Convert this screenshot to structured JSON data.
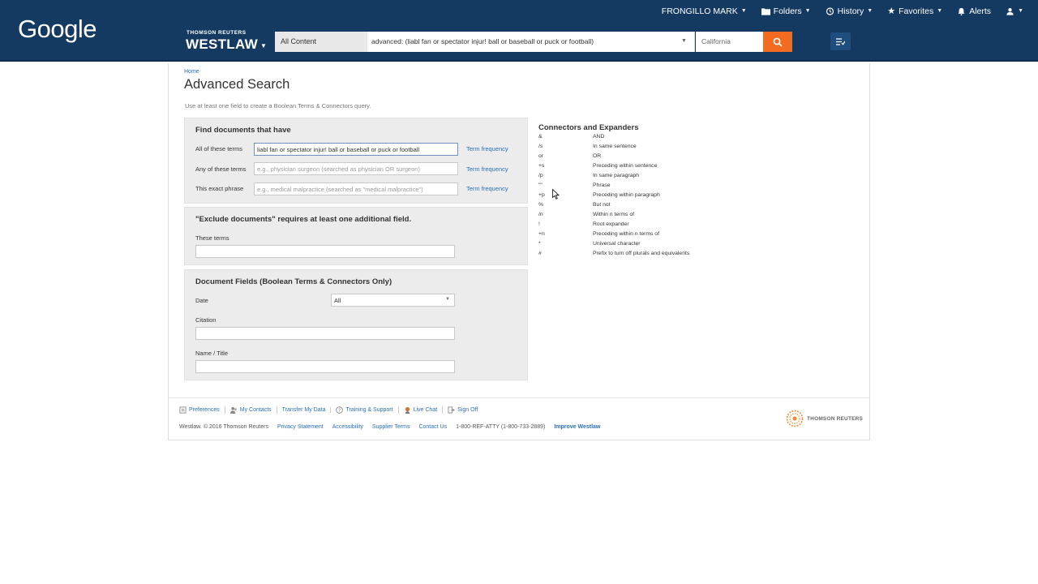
{
  "browser": {
    "logo": "Google"
  },
  "userbar": {
    "user": "FRONGILLO MARK",
    "folders": "Folders",
    "history": "History",
    "favorites": "Favorites",
    "alerts": "Alerts"
  },
  "brand": {
    "small": "THOMSON REUTERS",
    "big": "WESTLAW"
  },
  "search": {
    "content_type": "All Content",
    "query": "advanced: (liabl fan or spectator injur! ball or baseball or puck or football)",
    "jurisdiction": "California"
  },
  "page": {
    "breadcrumb": "Home",
    "title": "Advanced Search",
    "intro": "Use at least one field to create a Boolean Terms & Connectors query."
  },
  "find_panel": {
    "heading": "Find documents that have",
    "rows": [
      {
        "label": "All of these terms",
        "value": "liabl fan or spectator injur! ball or baseball or puck or football",
        "placeholder": "",
        "link": "Term frequency"
      },
      {
        "label": "Any of these terms",
        "value": "",
        "placeholder": "e.g., physician surgeon (searched as physician OR surgeon)",
        "link": "Term frequency"
      },
      {
        "label": "This exact phrase",
        "value": "",
        "placeholder": "e.g., medical malpractice (searched as \"medical malpractice\")",
        "link": "Term frequency"
      }
    ]
  },
  "exclude_panel": {
    "heading": "\"Exclude documents\" requires at least one additional field.",
    "label": "These terms"
  },
  "fields_panel": {
    "heading": "Document Fields (Boolean Terms & Connectors Only)",
    "date_label": "Date",
    "date_value": "All",
    "citation_label": "Citation",
    "name_label": "Name / Title"
  },
  "connectors": {
    "title": "Connectors and Expanders",
    "items": [
      {
        "sym": "&",
        "desc": "AND"
      },
      {
        "sym": "/s",
        "desc": "In same sentence"
      },
      {
        "sym": "or",
        "desc": "OR"
      },
      {
        "sym": "+s",
        "desc": "Preceding within sentence"
      },
      {
        "sym": "/p",
        "desc": "In same paragraph"
      },
      {
        "sym": "\"\"",
        "desc": "Phrase"
      },
      {
        "sym": "+p",
        "desc": "Preceding within paragraph"
      },
      {
        "sym": "%",
        "desc": "But not"
      },
      {
        "sym": "/n",
        "desc": "Within n terms of"
      },
      {
        "sym": "!",
        "desc": "Root expander"
      },
      {
        "sym": "+n",
        "desc": "Preceding within n terms of"
      },
      {
        "sym": "*",
        "desc": "Universal character"
      },
      {
        "sym": "#",
        "desc": "Prefix to turn off plurals and equivalents"
      }
    ]
  },
  "footer": {
    "links": [
      "Preferences",
      "My Contacts",
      "Transfer My Data",
      "Training & Support",
      "Live Chat",
      "Sign Off"
    ],
    "copyright": "Westlaw. © 2016 Thomson Reuters",
    "privacy": "Privacy Statement",
    "accessibility": "Accessibility",
    "supplier": "Supplier Terms",
    "contact": "Contact Us",
    "phone": "1-800-REF-ATTY (1-800-733-2889)",
    "improve": "Improve Westlaw",
    "logo_text": "THOMSON REUTERS"
  },
  "colors": {
    "nav": "#153a62",
    "accent": "#f26b21",
    "link": "#2a6ebb"
  }
}
